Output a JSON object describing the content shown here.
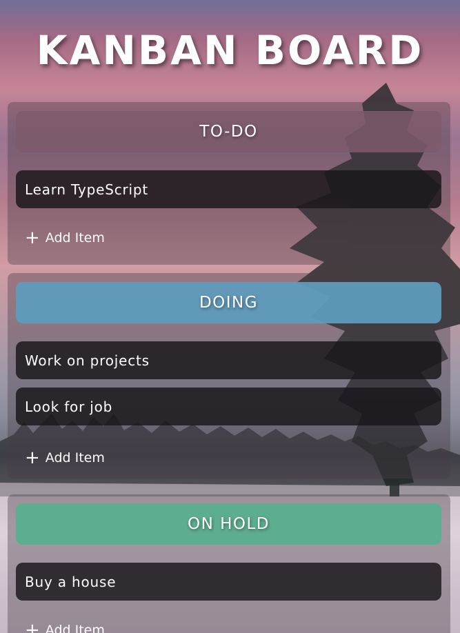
{
  "title": "KANBAN BOARD",
  "colors": {
    "todo_header": "#7d5a6c",
    "doing_header": "#5f9bbb",
    "onhold_header": "#5aaf8f",
    "item_bg": "#1c181c"
  },
  "columns": [
    {
      "header": "TO-DO",
      "items": [
        "Learn TypeScript"
      ],
      "add_label": "Add Item",
      "add_icon": "+"
    },
    {
      "header": "DOING",
      "items": [
        "Work on projects",
        "Look for job"
      ],
      "add_label": "Add Item",
      "add_icon": "+"
    },
    {
      "header": "ON HOLD",
      "items": [
        "Buy a house"
      ],
      "add_label": "Add Item",
      "add_icon": "+"
    }
  ]
}
